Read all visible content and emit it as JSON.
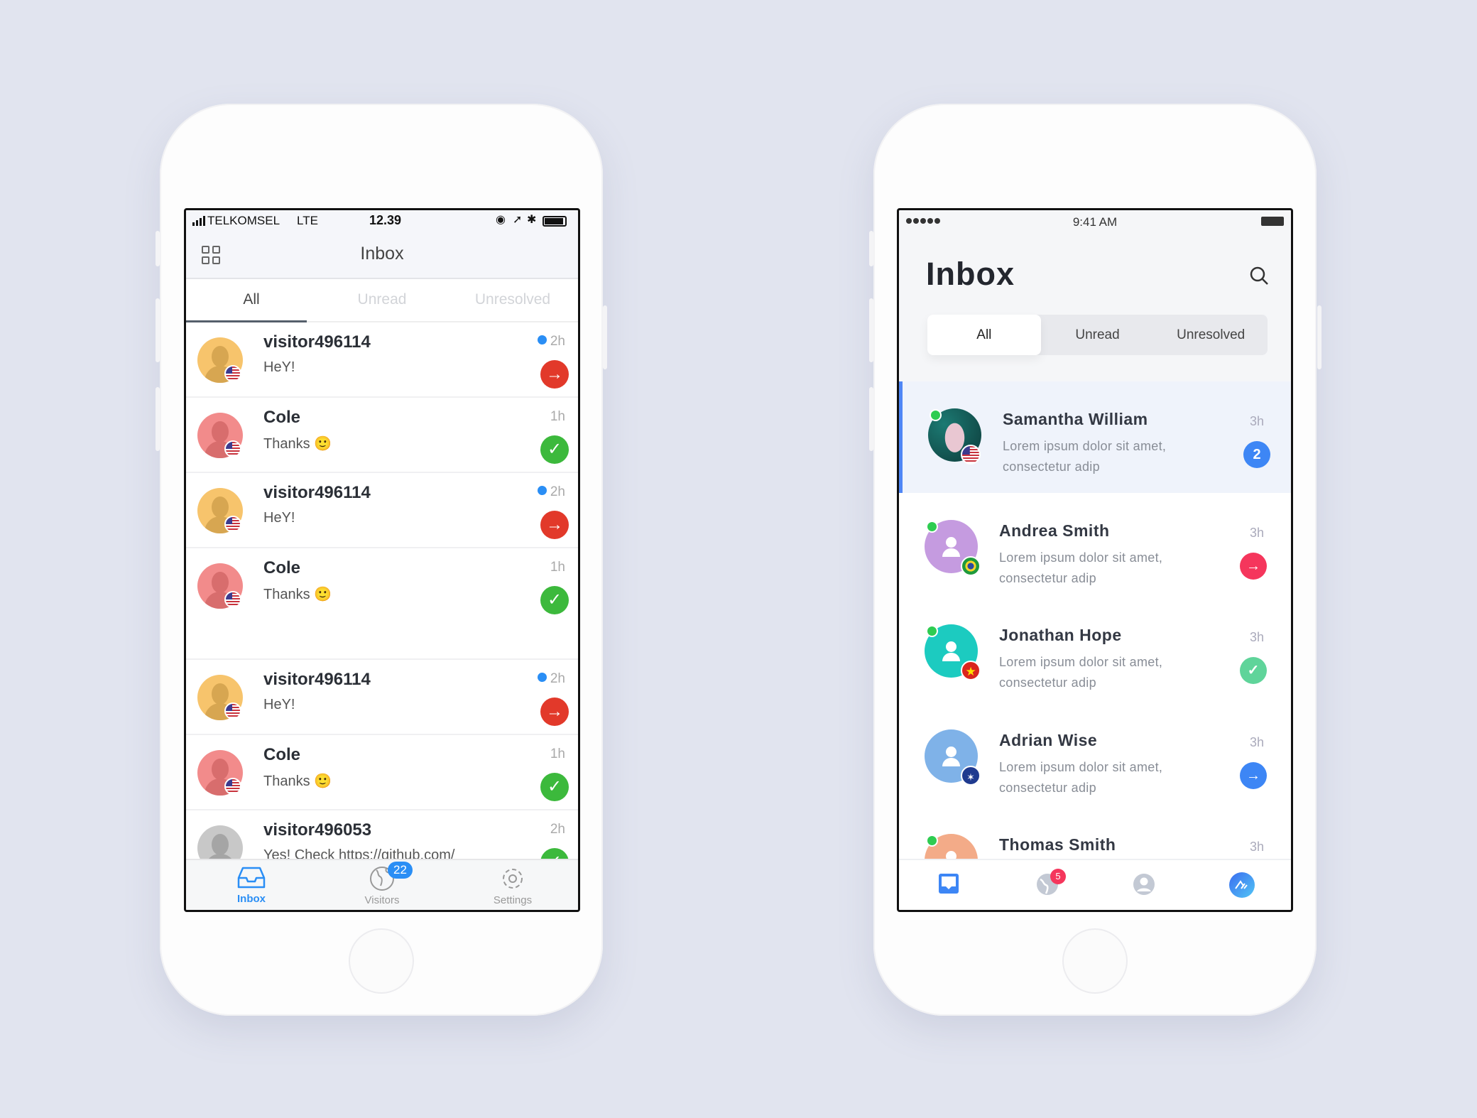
{
  "left": {
    "status": {
      "carrier": "TELKOMSEL",
      "network": "LTE",
      "time": "12.39"
    },
    "header": {
      "title": "Inbox",
      "menu_icon": "grid-icon"
    },
    "tabs": [
      {
        "label": "All",
        "active": true
      },
      {
        "label": "Unread"
      },
      {
        "label": "Unresolved"
      }
    ],
    "rows": [
      {
        "name": "visitor496114",
        "message": "HeY!",
        "time": "2h",
        "unread": true,
        "action": "arrow",
        "avatar": "#f7c46c",
        "avatar_dark": "#d7a651",
        "flag": "us"
      },
      {
        "name": "Cole",
        "message": "Thanks 🙂",
        "time": "1h",
        "action": "check",
        "avatar": "#f28b8b",
        "avatar_dark": "#d86d6d",
        "flag": "us"
      },
      {
        "name": "visitor496114",
        "message": "HeY!",
        "time": "2h",
        "unread": true,
        "action": "arrow",
        "avatar": "#f7c46c",
        "avatar_dark": "#d7a651",
        "flag": "us"
      },
      {
        "name": "Cole",
        "message": "Thanks 🙂",
        "time": "1h",
        "action": "check",
        "avatar": "#f28b8b",
        "avatar_dark": "#d86d6d",
        "flag": "us",
        "tall": true
      },
      {
        "name": "visitor496114",
        "message": "HeY!",
        "time": "2h",
        "unread": true,
        "action": "arrow",
        "avatar": "#f7c46c",
        "avatar_dark": "#d7a651",
        "flag": "us"
      },
      {
        "name": "Cole",
        "message": "Thanks 🙂",
        "time": "1h",
        "action": "check",
        "avatar": "#f28b8b",
        "avatar_dark": "#d86d6d",
        "flag": "us"
      },
      {
        "name": "visitor496053",
        "message": "Yes! Check https://github.com/",
        "time": "2h",
        "action": "check",
        "avatar": "#c8c8c8",
        "avatar_dark": "#a5a5a5"
      }
    ],
    "tabbar": [
      {
        "label": "Inbox",
        "icon": "inbox-tray-icon",
        "active": true
      },
      {
        "label": "Visitors",
        "icon": "globe-icon",
        "badge": "22"
      },
      {
        "label": "Settings",
        "icon": "gear-icon"
      }
    ],
    "colors": {
      "accent": "#2a8ef5",
      "arrow": "#e2392a",
      "check": "#3cb93c"
    }
  },
  "right": {
    "status": {
      "time": "9:41 AM"
    },
    "title": "Inbox",
    "search_icon": "search-icon",
    "tabs": [
      {
        "label": "All",
        "active": true
      },
      {
        "label": "Unread"
      },
      {
        "label": "Unresolved"
      }
    ],
    "rows": [
      {
        "name": "Samantha William",
        "message": "Lorem ipsum dolor sit amet, consectetur adip",
        "time": "3h",
        "badge": "2",
        "action": "count",
        "online": true,
        "flag": "us",
        "photo": true,
        "selected": true
      },
      {
        "name": "Andrea Smith",
        "message": "Lorem ipsum dolor sit amet, consectetur adip",
        "time": "3h",
        "action": "arrow",
        "online": true,
        "flag": "br",
        "avatar": "#c59be0"
      },
      {
        "name": "Jonathan Hope",
        "message": "Lorem ipsum dolor sit amet, consectetur adip",
        "time": "3h",
        "action": "check",
        "online": true,
        "flag": "vn",
        "avatar": "#1ccbc0"
      },
      {
        "name": "Adrian Wise",
        "message": "Lorem ipsum dolor sit amet, consectetur adip",
        "time": "3h",
        "action": "arrow-blue",
        "flag": "au",
        "avatar": "#7fb2e8"
      },
      {
        "name": "Thomas Smith",
        "message": "",
        "time": "3h",
        "online": true,
        "avatar": "#f3ab88"
      }
    ],
    "tabbar": [
      {
        "icon": "inbox-icon",
        "active": true
      },
      {
        "icon": "globe-icon",
        "badge": "5"
      },
      {
        "icon": "user-icon"
      },
      {
        "icon": "brand-logo-icon"
      }
    ],
    "colors": {
      "accent": "#3d86f5",
      "count": "#3d86f5",
      "arrow": "#f5365c",
      "check": "#5fd49a",
      "arrow-blue": "#3d86f5",
      "online": "#2ecc51"
    }
  }
}
